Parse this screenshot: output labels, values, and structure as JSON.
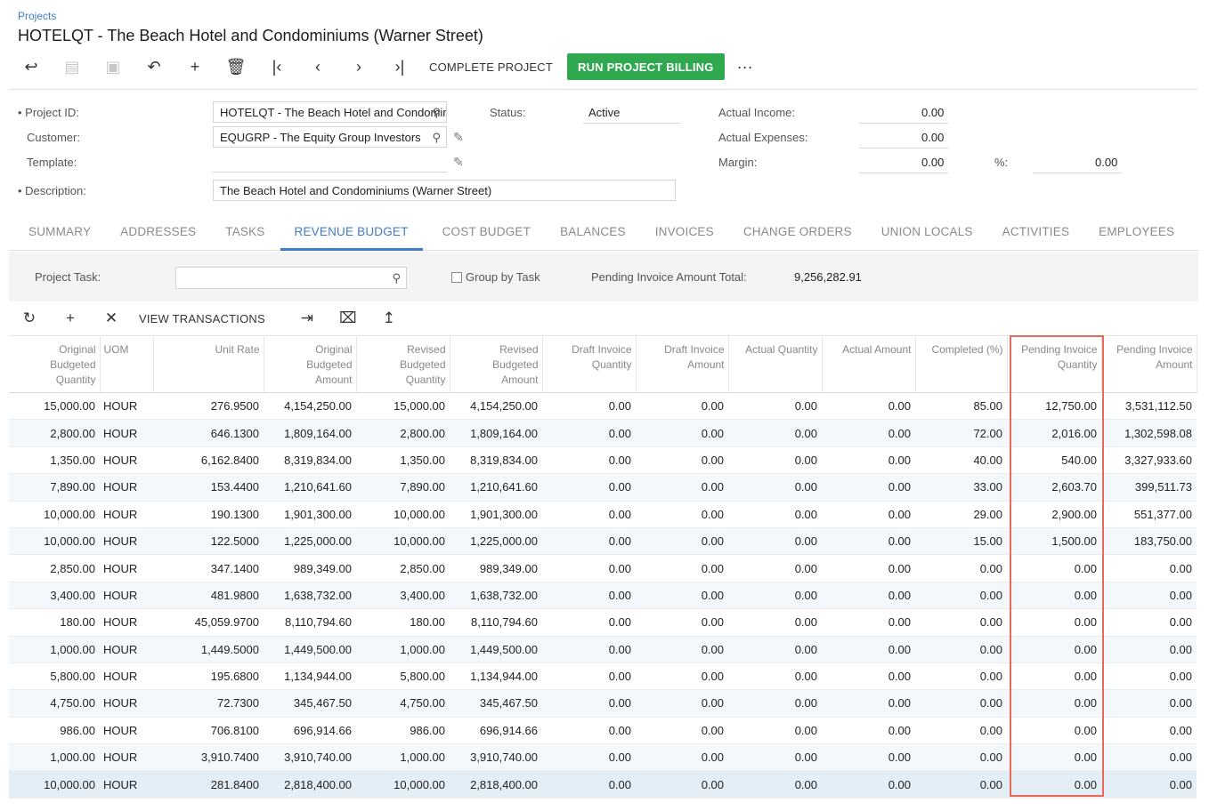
{
  "breadcrumb": "Projects",
  "page_title": "HOTELQT - The Beach Hotel and Condominiums (Warner Street)",
  "toolbar": {
    "complete_project": "COMPLETE PROJECT",
    "run_billing": "RUN PROJECT BILLING",
    "more": "···"
  },
  "form": {
    "project_id_label": "Project ID:",
    "project_id_value": "HOTELQT - The Beach Hotel and Condominiums (Warner Street)",
    "customer_label": "Customer:",
    "customer_value": "EQUGRP - The Equity Group Investors",
    "template_label": "Template:",
    "description_label": "Description:",
    "description_value": "The Beach Hotel and Condominiums (Warner Street)",
    "status_label": "Status:",
    "status_value": "Active",
    "actual_income_label": "Actual Income:",
    "actual_income_value": "0.00",
    "actual_expenses_label": "Actual Expenses:",
    "actual_expenses_value": "0.00",
    "margin_label": "Margin:",
    "margin_value": "0.00",
    "pct_label": "%:",
    "pct_value": "0.00"
  },
  "tabs": [
    "SUMMARY",
    "ADDRESSES",
    "TASKS",
    "REVENUE BUDGET",
    "COST BUDGET",
    "BALANCES",
    "INVOICES",
    "CHANGE ORDERS",
    "UNION LOCALS",
    "ACTIVITIES",
    "EMPLOYEES"
  ],
  "filter": {
    "project_task_label": "Project Task:",
    "group_by_task_label": "Group by Task",
    "pending_total_label": "Pending Invoice Amount Total:",
    "pending_total_value": "9,256,282.91"
  },
  "grid_toolbar": {
    "view_transactions": "VIEW TRANSACTIONS"
  },
  "grid": {
    "columns": [
      "Original Budgeted Quantity",
      "UOM",
      "Unit Rate",
      "Original Budgeted Amount",
      "Revised Budgeted Quantity",
      "Revised Budgeted Amount",
      "Draft Invoice Quantity",
      "Draft Invoice Amount",
      "Actual Quantity",
      "Actual Amount",
      "Completed (%)",
      "Pending Invoice Quantity",
      "Pending Invoice Amount"
    ],
    "rows": [
      [
        "15,000.00",
        "HOUR",
        "276.9500",
        "4,154,250.00",
        "15,000.00",
        "4,154,250.00",
        "0.00",
        "0.00",
        "0.00",
        "0.00",
        "85.00",
        "12,750.00",
        "3,531,112.50"
      ],
      [
        "2,800.00",
        "HOUR",
        "646.1300",
        "1,809,164.00",
        "2,800.00",
        "1,809,164.00",
        "0.00",
        "0.00",
        "0.00",
        "0.00",
        "72.00",
        "2,016.00",
        "1,302,598.08"
      ],
      [
        "1,350.00",
        "HOUR",
        "6,162.8400",
        "8,319,834.00",
        "1,350.00",
        "8,319,834.00",
        "0.00",
        "0.00",
        "0.00",
        "0.00",
        "40.00",
        "540.00",
        "3,327,933.60"
      ],
      [
        "7,890.00",
        "HOUR",
        "153.4400",
        "1,210,641.60",
        "7,890.00",
        "1,210,641.60",
        "0.00",
        "0.00",
        "0.00",
        "0.00",
        "33.00",
        "2,603.70",
        "399,511.73"
      ],
      [
        "10,000.00",
        "HOUR",
        "190.1300",
        "1,901,300.00",
        "10,000.00",
        "1,901,300.00",
        "0.00",
        "0.00",
        "0.00",
        "0.00",
        "29.00",
        "2,900.00",
        "551,377.00"
      ],
      [
        "10,000.00",
        "HOUR",
        "122.5000",
        "1,225,000.00",
        "10,000.00",
        "1,225,000.00",
        "0.00",
        "0.00",
        "0.00",
        "0.00",
        "15.00",
        "1,500.00",
        "183,750.00"
      ],
      [
        "2,850.00",
        "HOUR",
        "347.1400",
        "989,349.00",
        "2,850.00",
        "989,349.00",
        "0.00",
        "0.00",
        "0.00",
        "0.00",
        "0.00",
        "0.00",
        "0.00"
      ],
      [
        "3,400.00",
        "HOUR",
        "481.9800",
        "1,638,732.00",
        "3,400.00",
        "1,638,732.00",
        "0.00",
        "0.00",
        "0.00",
        "0.00",
        "0.00",
        "0.00",
        "0.00"
      ],
      [
        "180.00",
        "HOUR",
        "45,059.9700",
        "8,110,794.60",
        "180.00",
        "8,110,794.60",
        "0.00",
        "0.00",
        "0.00",
        "0.00",
        "0.00",
        "0.00",
        "0.00"
      ],
      [
        "1,000.00",
        "HOUR",
        "1,449.5000",
        "1,449,500.00",
        "1,000.00",
        "1,449,500.00",
        "0.00",
        "0.00",
        "0.00",
        "0.00",
        "0.00",
        "0.00",
        "0.00"
      ],
      [
        "5,800.00",
        "HOUR",
        "195.6800",
        "1,134,944.00",
        "5,800.00",
        "1,134,944.00",
        "0.00",
        "0.00",
        "0.00",
        "0.00",
        "0.00",
        "0.00",
        "0.00"
      ],
      [
        "4,750.00",
        "HOUR",
        "72.7300",
        "345,467.50",
        "4,750.00",
        "345,467.50",
        "0.00",
        "0.00",
        "0.00",
        "0.00",
        "0.00",
        "0.00",
        "0.00"
      ],
      [
        "986.00",
        "HOUR",
        "706.8100",
        "696,914.66",
        "986.00",
        "696,914.66",
        "0.00",
        "0.00",
        "0.00",
        "0.00",
        "0.00",
        "0.00",
        "0.00"
      ],
      [
        "1,000.00",
        "HOUR",
        "3,910.7400",
        "3,910,740.00",
        "1,000.00",
        "3,910,740.00",
        "0.00",
        "0.00",
        "0.00",
        "0.00",
        "0.00",
        "0.00",
        "0.00"
      ],
      [
        "10,000.00",
        "HOUR",
        "281.8400",
        "2,818,400.00",
        "10,000.00",
        "2,818,400.00",
        "0.00",
        "0.00",
        "0.00",
        "0.00",
        "0.00",
        "0.00",
        "0.00"
      ]
    ]
  },
  "colors": {
    "accent": "#3f7cc4",
    "green_button": "#2fa84f",
    "highlight": "#e86a5a"
  }
}
